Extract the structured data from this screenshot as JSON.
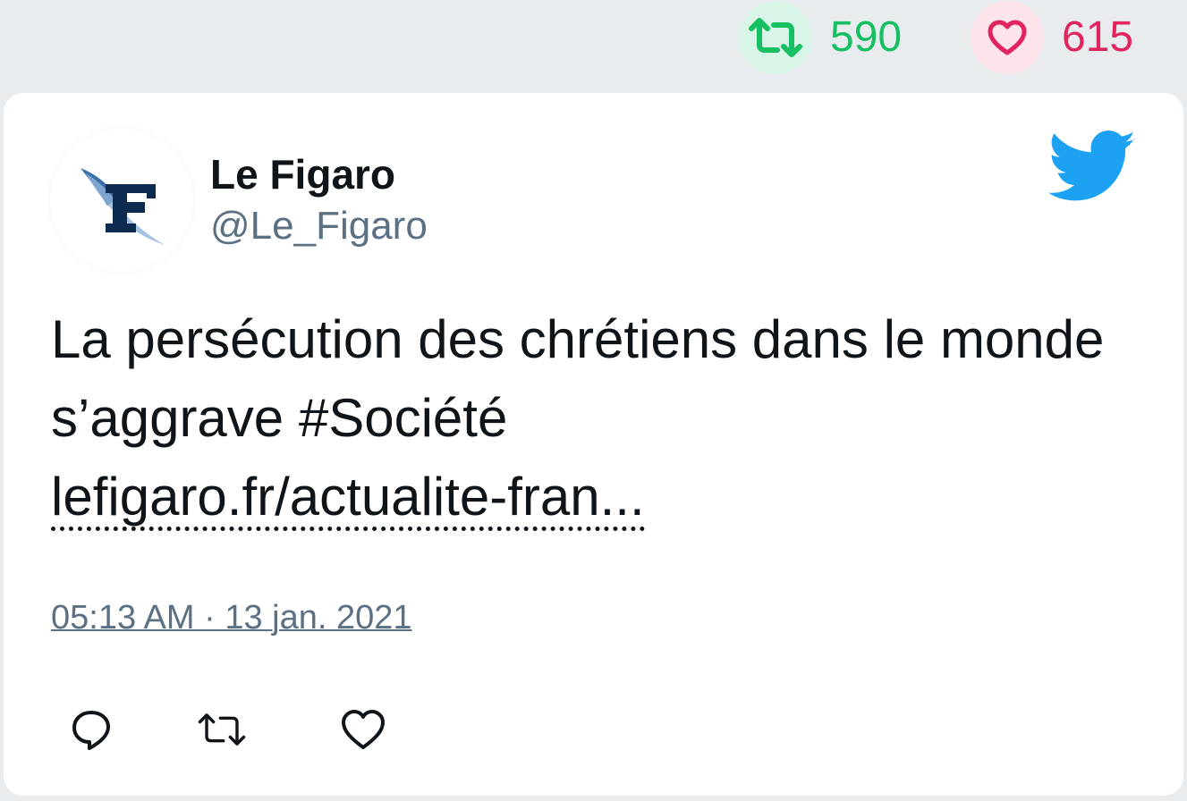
{
  "stats": {
    "retweet_count": "590",
    "like_count": "615",
    "retweet_color": "#17bf63",
    "like_color": "#e0245e"
  },
  "tweet": {
    "author_name": "Le Figaro",
    "author_handle": "@Le_Figaro",
    "text_main": "La persécution des chrétiens dans le monde s’aggrave #Société",
    "link_text": "lefigaro.fr/actualite-fran...",
    "timestamp": "05:13 AM · 13 jan. 2021"
  },
  "icons": {
    "retweet": "retweet-icon",
    "like": "heart-icon",
    "reply": "reply-icon",
    "brand": "twitter-bird-icon",
    "avatar": "le-figaro-logo"
  },
  "colors": {
    "twitter_blue": "#1da1f2",
    "text": "#0f1419",
    "muted": "#5b7083",
    "background": "#e9ecef"
  }
}
